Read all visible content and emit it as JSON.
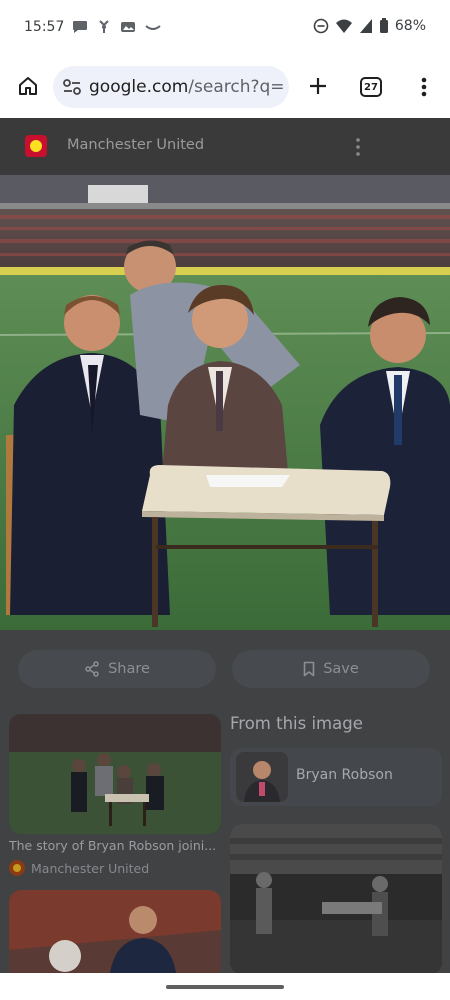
{
  "status_bar": {
    "time": "15:57",
    "battery": "68%"
  },
  "browser": {
    "url_domain": "google.com",
    "url_path": "/search?q=b",
    "tab_count": "27"
  },
  "viewer": {
    "source_title": "Manchester United",
    "share_label": "Share",
    "save_label": "Save"
  },
  "related": {
    "card1_title": "The story of Bryan Robson joini...",
    "card1_source": "Manchester United",
    "from_image_heading": "From this image",
    "entity_name": "Bryan Robson"
  },
  "colors": {
    "overlay_bg": "#404244",
    "header_bg": "#3a3a3a",
    "brand_red": "#c8102e"
  }
}
